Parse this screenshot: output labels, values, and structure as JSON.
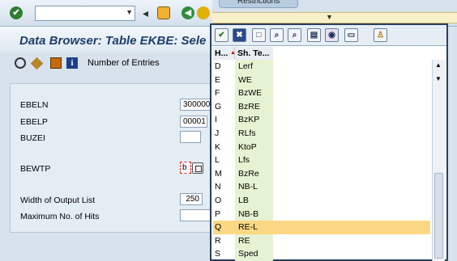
{
  "toolbar": {
    "command_value": "",
    "check_icon": "enter-check-icon",
    "save_icon": "save-icon",
    "back_icon": "back-green-icon",
    "exit_icon": "exit-yellow-icon"
  },
  "title": "Data Browser: Table EKBE: Sele",
  "app_toolbar": {
    "number_of_entries_label": "Number of Entries"
  },
  "form": {
    "fields": [
      {
        "label": "EBELN",
        "value": "300000"
      },
      {
        "label": "EBELP",
        "value": "00001"
      },
      {
        "label": "BUZEI",
        "value": ""
      },
      {
        "label": "BEWTP",
        "value": "b"
      },
      {
        "label": "Width of Output List",
        "value": "250"
      },
      {
        "label": "Maximum No. of Hits",
        "value": ""
      }
    ]
  },
  "popup": {
    "tab_label": "Restrictions",
    "columns": [
      "H...",
      "Sh. Te..."
    ],
    "rows": [
      {
        "key": "D",
        "text": "Lerf"
      },
      {
        "key": "E",
        "text": "WE"
      },
      {
        "key": "F",
        "text": "BzWE"
      },
      {
        "key": "G",
        "text": "BzRE"
      },
      {
        "key": "I",
        "text": "BzKP"
      },
      {
        "key": "J",
        "text": "RLfs"
      },
      {
        "key": "K",
        "text": "KtoP"
      },
      {
        "key": "L",
        "text": "Lfs"
      },
      {
        "key": "M",
        "text": "BzRe"
      },
      {
        "key": "N",
        "text": "NB-L"
      },
      {
        "key": "O",
        "text": "LB"
      },
      {
        "key": "P",
        "text": "NB-B"
      },
      {
        "key": "Q",
        "text": "RE-L"
      },
      {
        "key": "R",
        "text": "RE"
      },
      {
        "key": "S",
        "text": "Sped"
      }
    ],
    "selected_key": "Q",
    "colors": {
      "selected_row": "#fcd884",
      "key_column": "#e6f3d2"
    }
  }
}
